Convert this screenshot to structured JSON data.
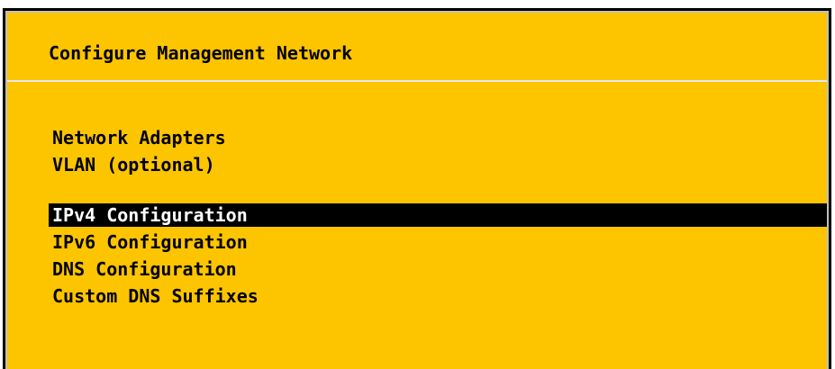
{
  "window_title": "Configure Management Network",
  "menu": {
    "items": [
      {
        "label": "Network Adapters",
        "selected": false
      },
      {
        "label": "VLAN (optional)",
        "selected": false
      },
      {
        "label": "IPv4 Configuration",
        "selected": true
      },
      {
        "label": "IPv6 Configuration",
        "selected": false
      },
      {
        "label": "DNS Configuration",
        "selected": false
      },
      {
        "label": "Custom DNS Suffixes",
        "selected": false
      }
    ]
  },
  "colors": {
    "panel_background": "#fcc500",
    "selection_background": "#000000",
    "selection_text": "#ffffff",
    "text": "#000000"
  }
}
